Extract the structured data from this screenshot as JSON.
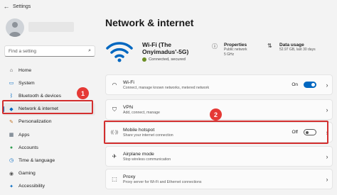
{
  "app": {
    "title": "Settings"
  },
  "search": {
    "placeholder": "Find a setting"
  },
  "sidebar": {
    "items": [
      {
        "label": "Home",
        "icon": "home-icon",
        "glyph": "⌂"
      },
      {
        "label": "System",
        "icon": "system-icon",
        "glyph": "▭"
      },
      {
        "label": "Bluetooth & devices",
        "icon": "bluetooth-icon",
        "glyph": "ᛒ"
      },
      {
        "label": "Network & internet",
        "icon": "network-icon",
        "glyph": "◆"
      },
      {
        "label": "Personalization",
        "icon": "personalization-icon",
        "glyph": "✎"
      },
      {
        "label": "Apps",
        "icon": "apps-icon",
        "glyph": "▦"
      },
      {
        "label": "Accounts",
        "icon": "accounts-icon",
        "glyph": "●"
      },
      {
        "label": "Time & language",
        "icon": "time-language-icon",
        "glyph": "◷"
      },
      {
        "label": "Gaming",
        "icon": "gaming-icon",
        "glyph": "◉"
      },
      {
        "label": "Accessibility",
        "icon": "accessibility-icon",
        "glyph": "✦"
      }
    ]
  },
  "main": {
    "title": "Network & internet",
    "connection": {
      "name": "Wi-Fi (The Onyimadus'-5G)",
      "status": "Connected, secured"
    },
    "properties": {
      "title": "Properties",
      "sub1": "Public network",
      "sub2": "5 GHz"
    },
    "data_usage": {
      "title": "Data usage",
      "sub": "52.97 GB, last 30 days"
    },
    "cards": [
      {
        "label": "Wi-Fi",
        "sub": "Connect, manage known networks, metered network",
        "state": "On",
        "icon": "wifi-icon",
        "glyph": "◠"
      },
      {
        "label": "VPN",
        "sub": "Add, connect, manage",
        "state": "",
        "icon": "vpn-icon",
        "glyph": "⛉"
      },
      {
        "label": "Mobile hotspot",
        "sub": "Share your internet connection",
        "state": "Off",
        "icon": "hotspot-icon",
        "glyph": "((·))"
      },
      {
        "label": "Airplane mode",
        "sub": "Stop wireless communication",
        "state": "",
        "icon": "airplane-icon",
        "glyph": "✈"
      },
      {
        "label": "Proxy",
        "sub": "Proxy server for Wi-Fi and Ethernet connections",
        "state": "",
        "icon": "proxy-icon",
        "glyph": "⬚"
      }
    ]
  },
  "annotations": {
    "badge1": "1",
    "badge2": "2"
  },
  "colors": {
    "accent": "#0067c0",
    "highlight": "#d32f2f"
  }
}
